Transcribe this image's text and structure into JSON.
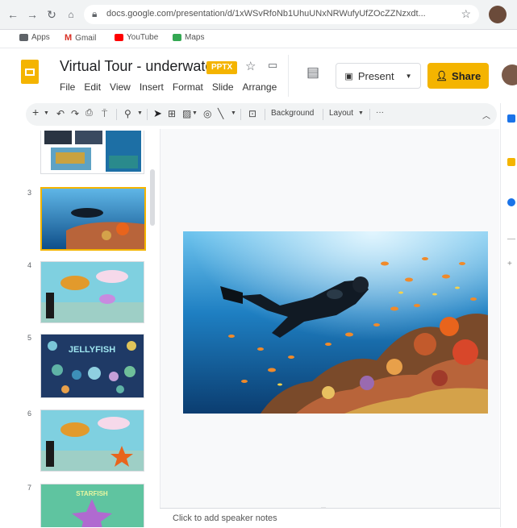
{
  "browser": {
    "url": "docs.google.com/presentation/d/1xWSvRfoNb1UhuUNxNRWufyUfZOcZZNzxdt...",
    "bookmarks": [
      {
        "label": "Apps",
        "color": "#5f6368"
      },
      {
        "label": "Gmail",
        "color": "#d93025"
      },
      {
        "label": "YouTube",
        "color": "#ff0000"
      },
      {
        "label": "Maps",
        "color": "#34a853"
      }
    ]
  },
  "doc": {
    "title": "Virtual Tour - underwater",
    "badge": "PPTX",
    "menus": [
      "File",
      "Edit",
      "View",
      "Insert",
      "Format",
      "Slide",
      "Arrange"
    ],
    "present_label": "Present",
    "share_label": "Share"
  },
  "toolbar": {
    "background_label": "Background",
    "layout_label": "Layout",
    "more_label": "···"
  },
  "filmstrip": {
    "slides": [
      {
        "number": "3"
      },
      {
        "number": "4"
      },
      {
        "number": "5"
      },
      {
        "number": "6"
      },
      {
        "number": "7"
      }
    ],
    "slide5_title": "JELLYFISH",
    "slide7_title": "STARFISH"
  },
  "notes": {
    "placeholder": "Click to add speaker notes"
  },
  "colors": {
    "accent": "#f4b400",
    "selected": "#fde293",
    "ocean": "#1e7fc2",
    "coral": "#e8641c"
  }
}
